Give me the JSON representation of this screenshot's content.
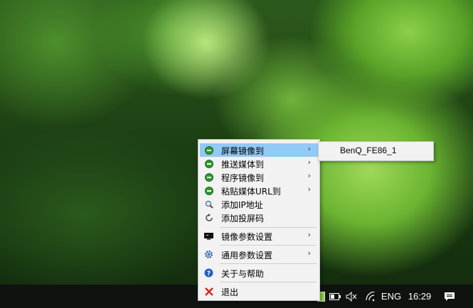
{
  "menu": {
    "items": [
      {
        "label": "屏幕镜像到",
        "icon": "airplay-green-icon",
        "submenu": true,
        "highlighted": true
      },
      {
        "label": "推送媒体到",
        "icon": "airplay-green-icon",
        "submenu": true
      },
      {
        "label": "程序镜像到",
        "icon": "airplay-green-icon",
        "submenu": true
      },
      {
        "label": "粘贴媒体URL到",
        "icon": "airplay-green-icon",
        "submenu": true
      },
      {
        "label": "添加IP地址",
        "icon": "magnifier-icon",
        "submenu": false
      },
      {
        "label": "添加投屏码",
        "icon": "refresh-icon",
        "submenu": false
      },
      {
        "label": "镜像参数设置",
        "icon": "monitor-icon",
        "submenu": true
      },
      {
        "label": "通用参数设置",
        "icon": "gear-icon",
        "submenu": true
      },
      {
        "label": "关于与帮助",
        "icon": "help-icon",
        "submenu": false
      },
      {
        "label": "退出",
        "icon": "close-red-icon",
        "submenu": false
      }
    ],
    "arrow": "›"
  },
  "submenu": {
    "items": [
      {
        "label": "BenQ_FE86_1"
      }
    ]
  },
  "taskbar": {
    "language": "ENG",
    "time": "16:29"
  },
  "colors": {
    "highlight": "#91c9f7",
    "menu_bg": "#f2f2f2",
    "taskbar_bg": "#0f1310",
    "exit_red": "#e02020"
  }
}
